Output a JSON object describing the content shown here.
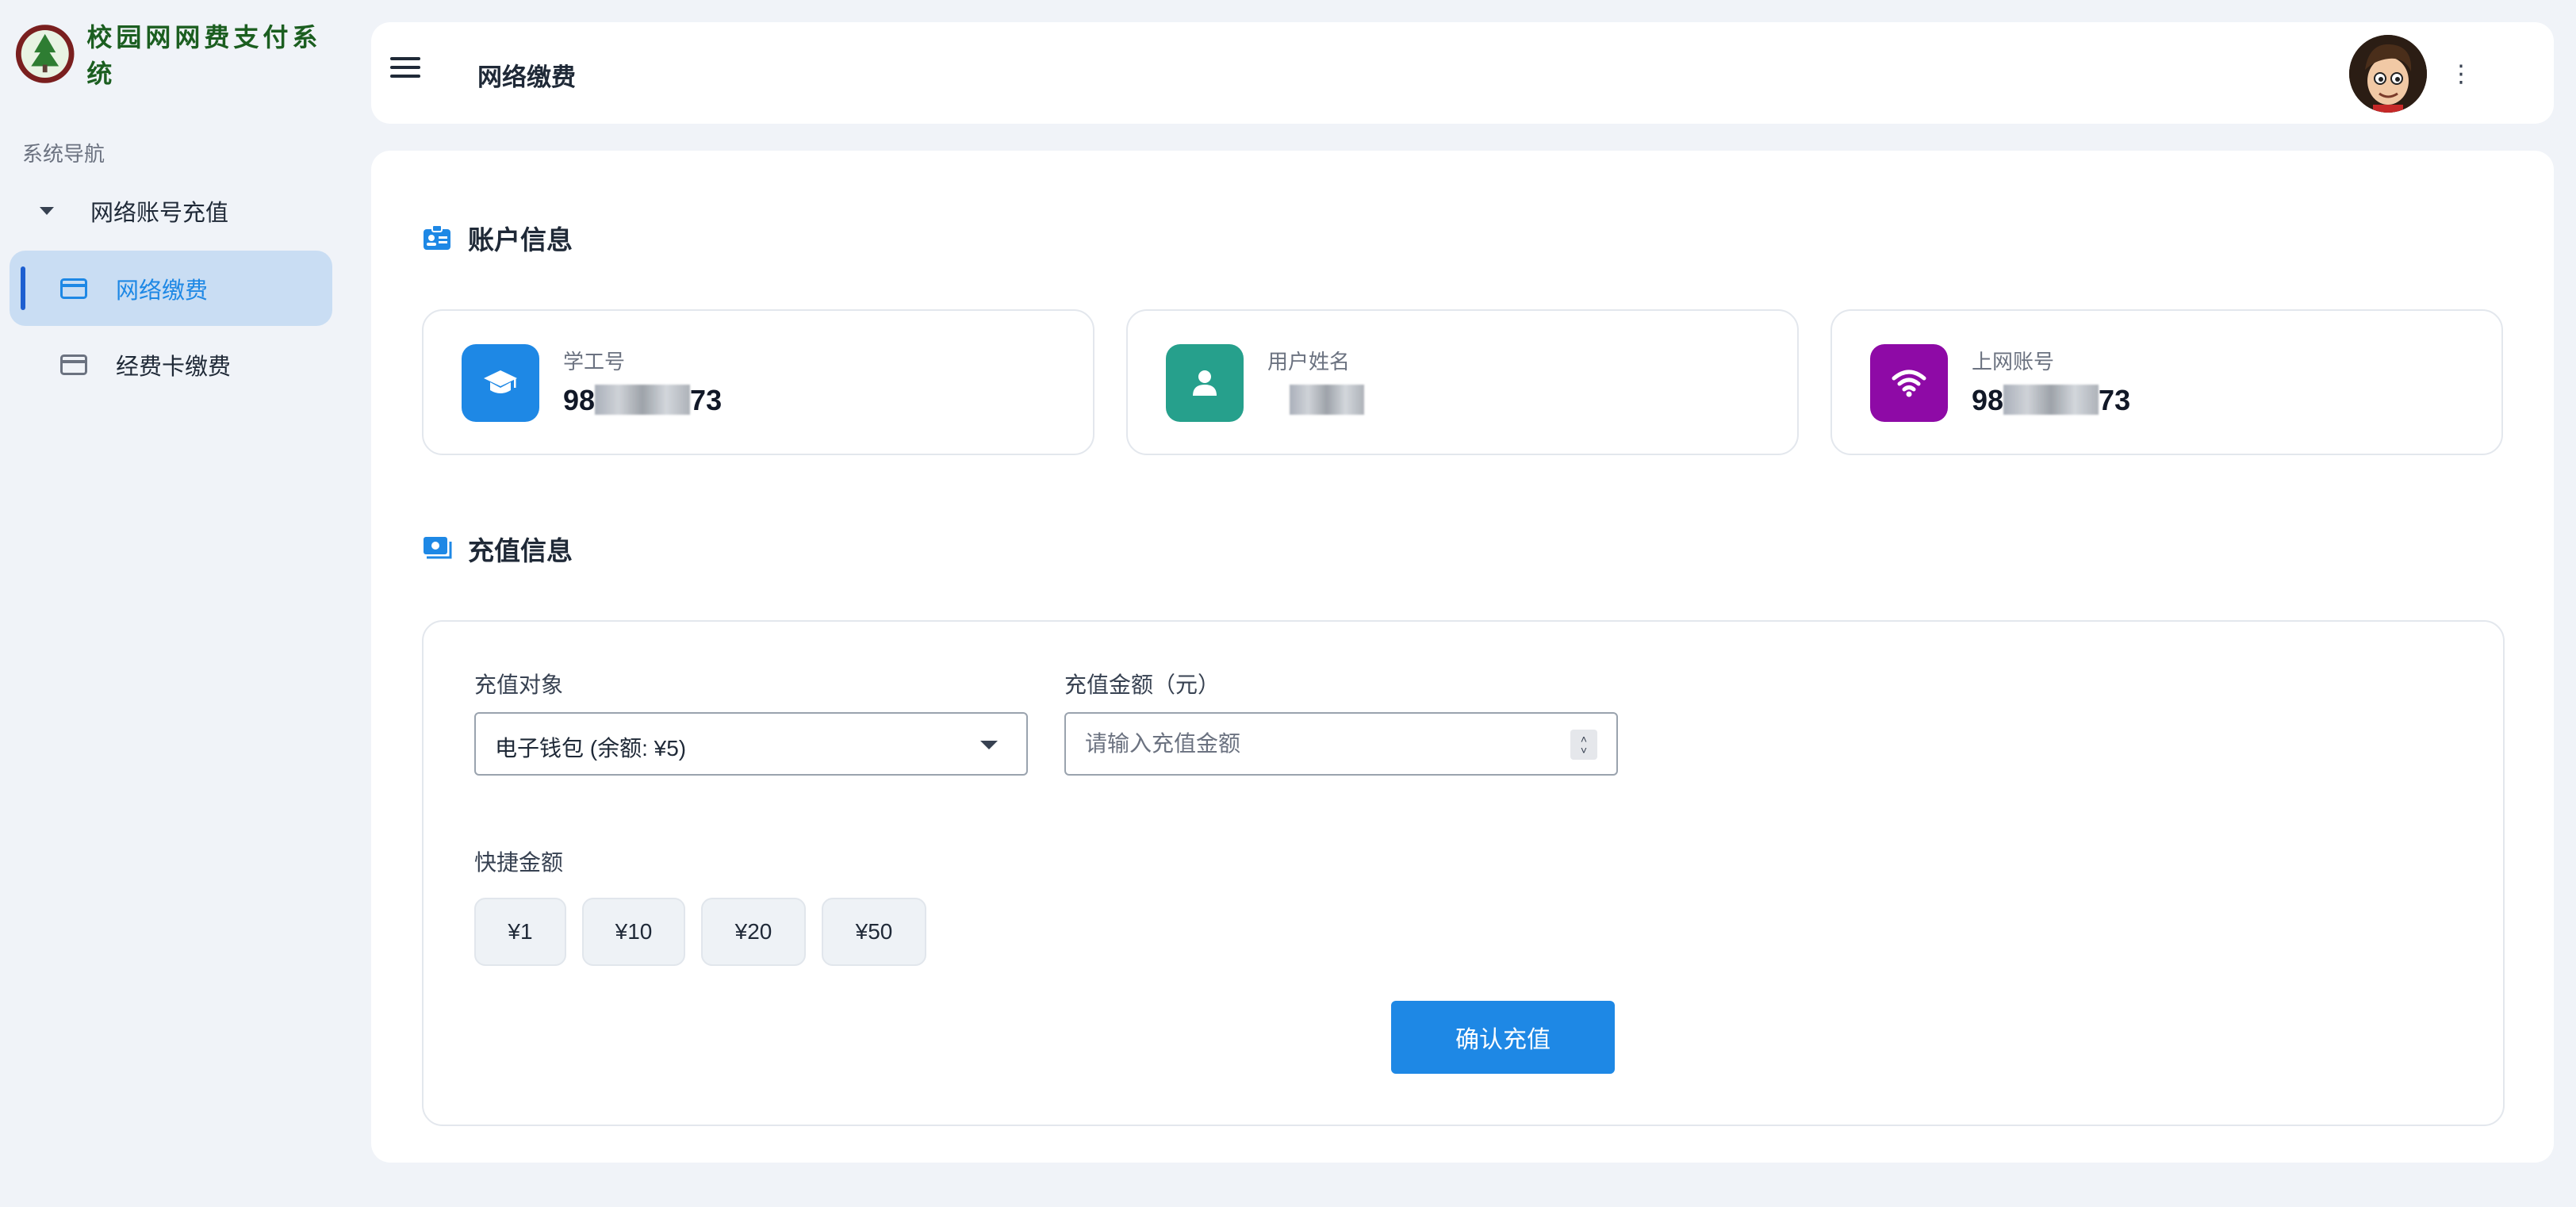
{
  "app": {
    "brand_title": "校园网网费支付系统",
    "logo_icon": "campus-emblem-icon"
  },
  "sidebar": {
    "caption": "系统导航",
    "group_label": "网络账号充值",
    "items": [
      {
        "label": "网络缴费",
        "icon": "credit-card-icon",
        "active": true
      },
      {
        "label": "经费卡缴费",
        "icon": "credit-card-icon",
        "active": false
      }
    ]
  },
  "header": {
    "title": "网络缴费",
    "menu_icon": "hamburger-menu-icon",
    "more_icon": "more-vertical-icon"
  },
  "account_section": {
    "title": "账户信息",
    "cards": [
      {
        "label": "学工号",
        "value_prefix": "98",
        "value_suffix": "73",
        "icon": "graduation-cap-icon",
        "color": "#1e88e5"
      },
      {
        "label": "用户姓名",
        "value_prefix": "",
        "value_suffix": "",
        "icon": "person-icon",
        "color": "#26a08c"
      },
      {
        "label": "上网账号",
        "value_prefix": "98",
        "value_suffix": "73",
        "icon": "wifi-icon",
        "color": "#8e0aa6"
      }
    ]
  },
  "recharge_section": {
    "title": "充值信息",
    "target_label": "充值对象",
    "target_value": "电子钱包 (余额: ¥5)",
    "amount_label": "充值金额（元）",
    "amount_placeholder": "请输入充值金额",
    "quick_label": "快捷金额",
    "quick_amounts": [
      "¥1",
      "¥10",
      "¥20",
      "¥50"
    ],
    "confirm_label": "确认充值"
  },
  "colors": {
    "accent": "#1e88e5",
    "background": "#f0f3f8",
    "active_nav": "#c9ddf3"
  }
}
